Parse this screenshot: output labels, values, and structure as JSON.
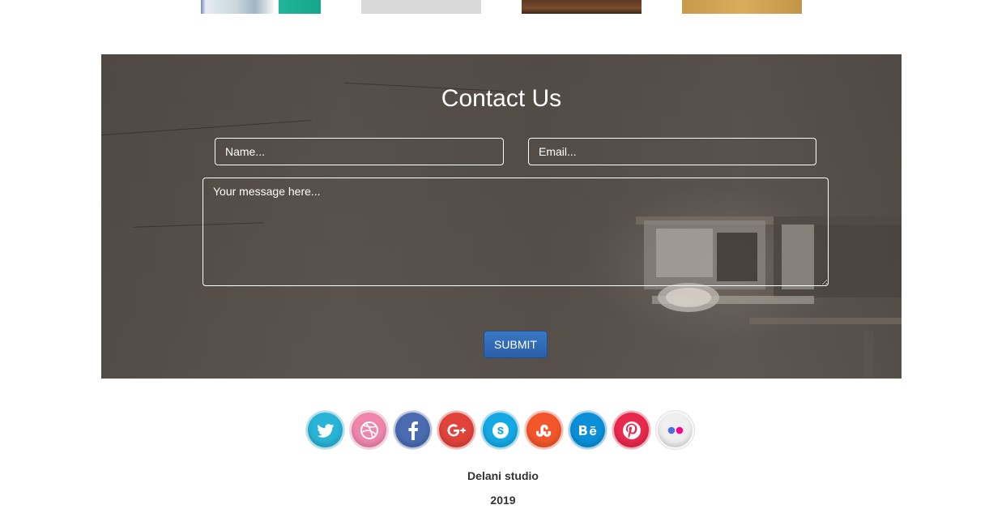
{
  "gallery": {
    "thumbnails": [
      "portfolio-thumb-ui",
      "portfolio-thumb-grey",
      "portfolio-thumb-wood",
      "portfolio-thumb-sand"
    ]
  },
  "contact": {
    "title": "Contact Us",
    "name_placeholder": "Name...",
    "email_placeholder": "Email...",
    "message_placeholder": "Your message here...",
    "submit_label": "SUBMIT"
  },
  "socials": [
    {
      "name": "twitter-icon",
      "color": "#29b3d6"
    },
    {
      "name": "dribbble-icon",
      "color": "#ef87ad"
    },
    {
      "name": "facebook-icon",
      "color": "#4a6bb0"
    },
    {
      "name": "google-plus-icon",
      "color": "#e0433a"
    },
    {
      "name": "skype-icon",
      "color": "#14a9e4"
    },
    {
      "name": "stumbleupon-icon",
      "color": "#f2562a"
    },
    {
      "name": "behance-icon",
      "color": "#0a8fd8"
    },
    {
      "name": "pinterest-icon",
      "color": "#e8284c"
    },
    {
      "name": "flickr-icon",
      "color": "#efefef"
    }
  ],
  "footer": {
    "studio": "Delani studio",
    "year": "2019"
  },
  "colors": {
    "submit": "#2a5ea8",
    "footer_text": "#333333"
  }
}
